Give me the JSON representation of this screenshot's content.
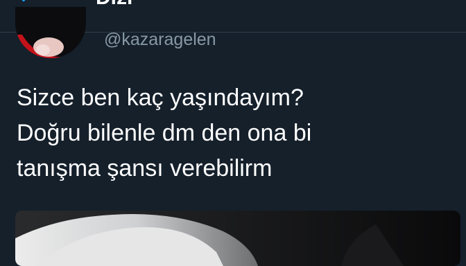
{
  "header": {
    "title": "Dizi"
  },
  "tweet": {
    "handle": "@kazaragelen",
    "text_lines": [
      "Sizce ben kaç yaşındayım?",
      "Doğru bilenle dm den ona bi",
      "tanışma şansı verebilirm"
    ]
  },
  "icons": {
    "back": "back-arrow-icon"
  },
  "colors": {
    "background": "#15202b",
    "accent": "#1da1f2",
    "text_primary": "#ffffff",
    "text_secondary": "#8899a6",
    "divider": "#2f3d4c"
  }
}
